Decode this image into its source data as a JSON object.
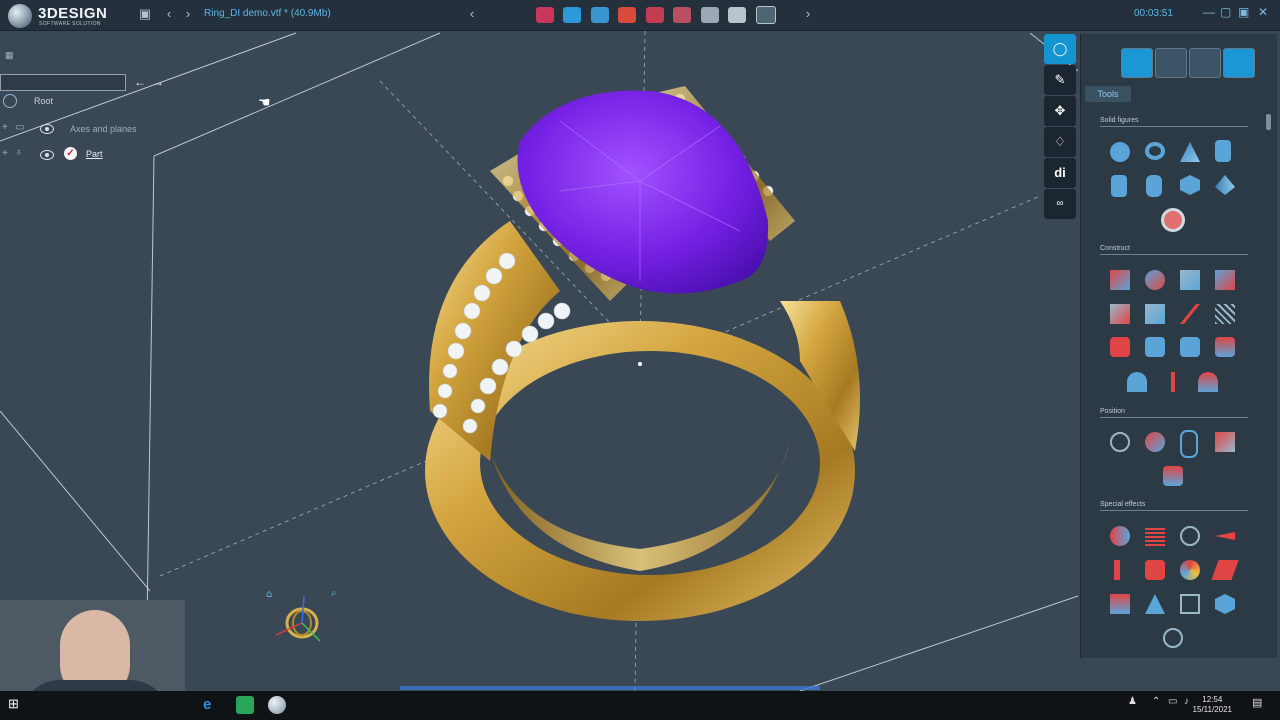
{
  "app": {
    "logo_name": "3DESIGN",
    "logo_sub": "SOFTWARE SOLUTION",
    "filename": "Ring_DI demo.vtf * (40.9Mb)",
    "timer": "00:03:51"
  },
  "tree": {
    "root_label": "Root",
    "items": [
      {
        "label": "Axes and planes"
      },
      {
        "label": "Part"
      }
    ]
  },
  "panel": {
    "tools_tab": "Tools",
    "sections": [
      {
        "title": "Solid figures"
      },
      {
        "title": "Construct"
      },
      {
        "title": "Position"
      },
      {
        "title": "Special effects"
      }
    ]
  },
  "taskbar": {
    "time": "12:54",
    "date": "15/11/2021"
  },
  "colors": {
    "accent": "#1594d2",
    "gem": "#7a1fe0",
    "gold": "#d8b24c",
    "background": "#3a4856"
  }
}
